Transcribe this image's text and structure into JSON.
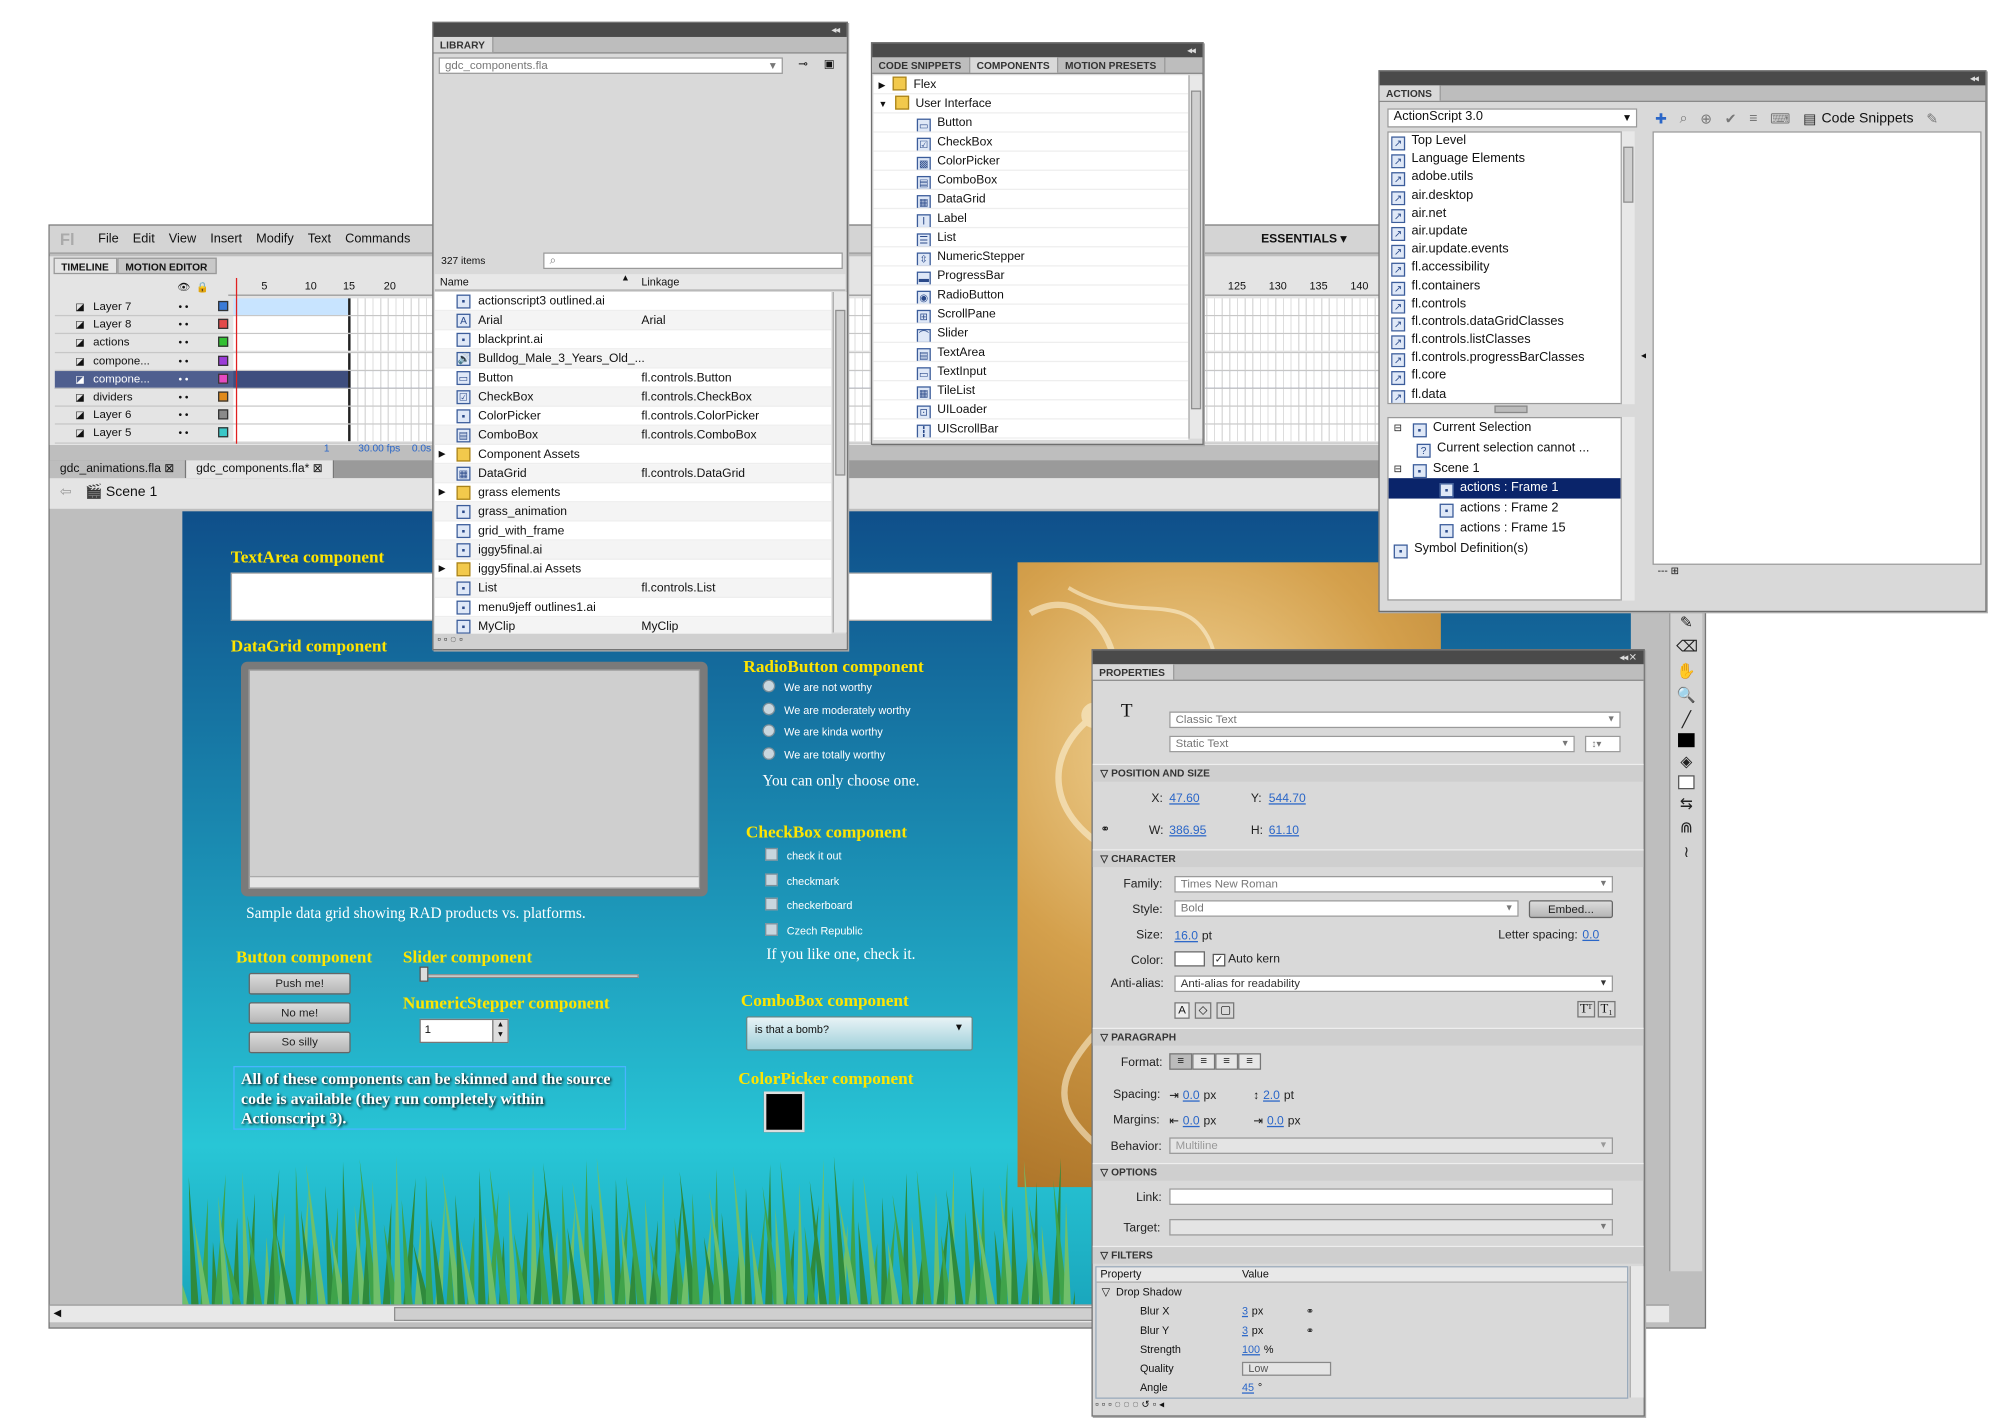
{
  "colors": {
    "accent": "#2a66c8",
    "stage_yellow": "#ffe500",
    "selection": "#0a246a"
  },
  "main": {
    "menu": [
      "File",
      "Edit",
      "View",
      "Insert",
      "Modify",
      "Text",
      "Commands"
    ],
    "workspace": "ESSENTIALS",
    "timeline_tabs": [
      "TIMELINE",
      "MOTION EDITOR"
    ],
    "frame_numbers_left": [
      "5",
      "10",
      "15",
      "20"
    ],
    "frame_numbers_right": [
      "125",
      "130",
      "135",
      "140"
    ],
    "layers": [
      "Layer 7",
      "Layer 8",
      "actions",
      "compone...",
      "compone...",
      "dividers",
      "Layer 6",
      "Layer 5"
    ],
    "fps": "30.00 fps",
    "time": "0.0s",
    "current_frame": "1",
    "doc_tabs": [
      "gdc_animations.fla",
      "gdc_components.fla*"
    ],
    "scene": "Scene 1"
  },
  "stage": {
    "textarea_h": "TextArea component",
    "datagrid_h": "DataGrid component",
    "datagrid_caption": "Sample data grid showing RAD products vs. platforms.",
    "button_h": "Button component",
    "buttons": [
      "Push me!",
      "No me!",
      "So silly"
    ],
    "slider_h": "Slider component",
    "stepper_h": "NumericStepper component",
    "stepper_value": "1",
    "skin_text": "All of these components can be skinned and the source code is available (they run completely within Actionscript 3).",
    "radio_h": "RadioButton component",
    "radios": [
      "We are not worthy",
      "We are moderately worthy",
      "We are kinda worthy",
      "We are totally worthy"
    ],
    "radio_caption": "You can only choose one.",
    "check_h": "CheckBox component",
    "checks": [
      "check it out",
      "checkmark",
      "checkerboard",
      "Czech Republic"
    ],
    "check_caption": "If you like one, check it.",
    "combo_h": "ComboBox component",
    "combo_value": "is that a bomb?",
    "color_h": "ColorPicker component"
  },
  "library": {
    "title": "LIBRARY",
    "file": "gdc_components.fla",
    "count": "327 items",
    "col_name": "Name",
    "col_linkage": "Linkage",
    "items": [
      {
        "name": "actionscript3 outlined.ai",
        "link": ""
      },
      {
        "name": "Arial",
        "link": "Arial"
      },
      {
        "name": "blackprint.ai",
        "link": ""
      },
      {
        "name": "Bulldog_Male_3_Years_Old_...",
        "link": ""
      },
      {
        "name": "Button",
        "link": "fl.controls.Button"
      },
      {
        "name": "CheckBox",
        "link": "fl.controls.CheckBox"
      },
      {
        "name": "ColorPicker",
        "link": "fl.controls.ColorPicker"
      },
      {
        "name": "ComboBox",
        "link": "fl.controls.ComboBox"
      },
      {
        "name": "Component Assets",
        "link": ""
      },
      {
        "name": "DataGrid",
        "link": "fl.controls.DataGrid"
      },
      {
        "name": "grass elements",
        "link": ""
      },
      {
        "name": "grass_animation",
        "link": ""
      },
      {
        "name": "grid_with_frame",
        "link": ""
      },
      {
        "name": "iggy5final.ai",
        "link": ""
      },
      {
        "name": "iggy5final.ai Assets",
        "link": ""
      },
      {
        "name": "List",
        "link": "fl.controls.List"
      },
      {
        "name": "menu9jeff outlines1.ai",
        "link": ""
      },
      {
        "name": "MyClip",
        "link": "MyClip"
      }
    ]
  },
  "components": {
    "tabs": [
      "CODE SNIPPETS",
      "COMPONENTS",
      "MOTION PRESETS"
    ],
    "folders": [
      "Flex",
      "User Interface"
    ],
    "items": [
      "Button",
      "CheckBox",
      "ColorPicker",
      "ComboBox",
      "DataGrid",
      "Label",
      "List",
      "NumericStepper",
      "ProgressBar",
      "RadioButton",
      "ScrollPane",
      "Slider",
      "TextArea",
      "TextInput",
      "TileList",
      "UILoader",
      "UIScrollBar"
    ]
  },
  "actions": {
    "title": "ACTIONS",
    "language": "ActionScript 3.0",
    "code_snippets": "Code Snippets",
    "toolbox": [
      "Top Level",
      "Language Elements",
      "adobe.utils",
      "air.desktop",
      "air.net",
      "air.update",
      "air.update.events",
      "fl.accessibility",
      "fl.containers",
      "fl.controls",
      "fl.controls.dataGridClasses",
      "fl.controls.listClasses",
      "fl.controls.progressBarClasses",
      "fl.core",
      "fl.data"
    ],
    "tree": [
      {
        "label": "Current Selection",
        "level": 0
      },
      {
        "label": "Current selection cannot ...",
        "level": 1
      },
      {
        "label": "Scene 1",
        "level": 0
      },
      {
        "label": "actions : Frame 1",
        "level": 2,
        "selected": true
      },
      {
        "label": "actions : Frame 2",
        "level": 2
      },
      {
        "label": "actions : Frame 15",
        "level": 2
      },
      {
        "label": "Symbol Definition(s)",
        "level": 0
      }
    ],
    "status": "---"
  },
  "properties": {
    "title": "PROPERTIES",
    "text_engine": "Classic Text",
    "text_type": "Static Text",
    "sec_position": "POSITION AND SIZE",
    "x_label": "X:",
    "x": "47.60",
    "y_label": "Y:",
    "y": "544.70",
    "w_label": "W:",
    "w": "386.95",
    "h_label": "H:",
    "h": "61.10",
    "sec_character": "CHARACTER",
    "family_label": "Family:",
    "family": "Times New Roman",
    "style_label": "Style:",
    "style": "Bold",
    "embed": "Embed...",
    "size_label": "Size:",
    "size": "16.0",
    "size_unit": "pt",
    "letter_label": "Letter spacing:",
    "letter": "0.0",
    "color_label": "Color:",
    "autokern": "Auto kern",
    "aa_label": "Anti-alias:",
    "aa": "Anti-alias for readability",
    "sec_paragraph": "PARAGRAPH",
    "format_label": "Format:",
    "spacing_label": "Spacing:",
    "spacing1": "0.0",
    "spacing_unit1": "px",
    "spacing2": "2.0",
    "spacing_unit2": "pt",
    "margins_label": "Margins:",
    "margin1": "0.0",
    "margin2": "0.0",
    "margin_unit": "px",
    "behavior_label": "Behavior:",
    "behavior": "Multiline",
    "sec_options": "OPTIONS",
    "link_label": "Link:",
    "target_label": "Target:",
    "sec_filters": "FILTERS",
    "col_property": "Property",
    "col_value": "Value",
    "filter_name": "Drop Shadow",
    "filter_rows": [
      {
        "p": "Blur X",
        "v": "3",
        "u": "px"
      },
      {
        "p": "Blur Y",
        "v": "3",
        "u": "px"
      },
      {
        "p": "Strength",
        "v": "100",
        "u": "%"
      },
      {
        "p": "Quality",
        "v": "Low",
        "u": ""
      },
      {
        "p": "Angle",
        "v": "45",
        "u": "°"
      }
    ]
  }
}
